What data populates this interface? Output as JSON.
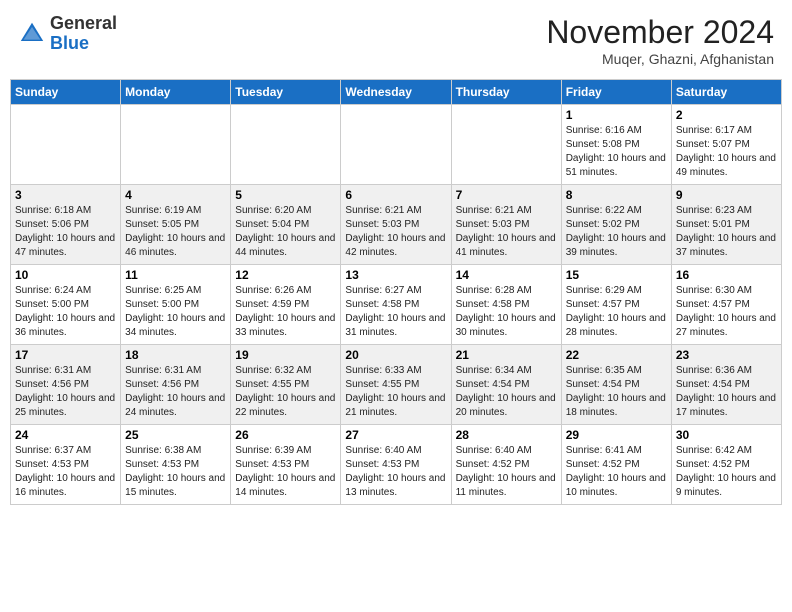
{
  "header": {
    "logo": {
      "general": "General",
      "blue": "Blue"
    },
    "month": "November 2024",
    "location": "Muqer, Ghazni, Afghanistan"
  },
  "weekdays": [
    "Sunday",
    "Monday",
    "Tuesday",
    "Wednesday",
    "Thursday",
    "Friday",
    "Saturday"
  ],
  "weeks": [
    [
      {
        "day": "",
        "info": ""
      },
      {
        "day": "",
        "info": ""
      },
      {
        "day": "",
        "info": ""
      },
      {
        "day": "",
        "info": ""
      },
      {
        "day": "",
        "info": ""
      },
      {
        "day": "1",
        "info": "Sunrise: 6:16 AM\nSunset: 5:08 PM\nDaylight: 10 hours and 51 minutes."
      },
      {
        "day": "2",
        "info": "Sunrise: 6:17 AM\nSunset: 5:07 PM\nDaylight: 10 hours and 49 minutes."
      }
    ],
    [
      {
        "day": "3",
        "info": "Sunrise: 6:18 AM\nSunset: 5:06 PM\nDaylight: 10 hours and 47 minutes."
      },
      {
        "day": "4",
        "info": "Sunrise: 6:19 AM\nSunset: 5:05 PM\nDaylight: 10 hours and 46 minutes."
      },
      {
        "day": "5",
        "info": "Sunrise: 6:20 AM\nSunset: 5:04 PM\nDaylight: 10 hours and 44 minutes."
      },
      {
        "day": "6",
        "info": "Sunrise: 6:21 AM\nSunset: 5:03 PM\nDaylight: 10 hours and 42 minutes."
      },
      {
        "day": "7",
        "info": "Sunrise: 6:21 AM\nSunset: 5:03 PM\nDaylight: 10 hours and 41 minutes."
      },
      {
        "day": "8",
        "info": "Sunrise: 6:22 AM\nSunset: 5:02 PM\nDaylight: 10 hours and 39 minutes."
      },
      {
        "day": "9",
        "info": "Sunrise: 6:23 AM\nSunset: 5:01 PM\nDaylight: 10 hours and 37 minutes."
      }
    ],
    [
      {
        "day": "10",
        "info": "Sunrise: 6:24 AM\nSunset: 5:00 PM\nDaylight: 10 hours and 36 minutes."
      },
      {
        "day": "11",
        "info": "Sunrise: 6:25 AM\nSunset: 5:00 PM\nDaylight: 10 hours and 34 minutes."
      },
      {
        "day": "12",
        "info": "Sunrise: 6:26 AM\nSunset: 4:59 PM\nDaylight: 10 hours and 33 minutes."
      },
      {
        "day": "13",
        "info": "Sunrise: 6:27 AM\nSunset: 4:58 PM\nDaylight: 10 hours and 31 minutes."
      },
      {
        "day": "14",
        "info": "Sunrise: 6:28 AM\nSunset: 4:58 PM\nDaylight: 10 hours and 30 minutes."
      },
      {
        "day": "15",
        "info": "Sunrise: 6:29 AM\nSunset: 4:57 PM\nDaylight: 10 hours and 28 minutes."
      },
      {
        "day": "16",
        "info": "Sunrise: 6:30 AM\nSunset: 4:57 PM\nDaylight: 10 hours and 27 minutes."
      }
    ],
    [
      {
        "day": "17",
        "info": "Sunrise: 6:31 AM\nSunset: 4:56 PM\nDaylight: 10 hours and 25 minutes."
      },
      {
        "day": "18",
        "info": "Sunrise: 6:31 AM\nSunset: 4:56 PM\nDaylight: 10 hours and 24 minutes."
      },
      {
        "day": "19",
        "info": "Sunrise: 6:32 AM\nSunset: 4:55 PM\nDaylight: 10 hours and 22 minutes."
      },
      {
        "day": "20",
        "info": "Sunrise: 6:33 AM\nSunset: 4:55 PM\nDaylight: 10 hours and 21 minutes."
      },
      {
        "day": "21",
        "info": "Sunrise: 6:34 AM\nSunset: 4:54 PM\nDaylight: 10 hours and 20 minutes."
      },
      {
        "day": "22",
        "info": "Sunrise: 6:35 AM\nSunset: 4:54 PM\nDaylight: 10 hours and 18 minutes."
      },
      {
        "day": "23",
        "info": "Sunrise: 6:36 AM\nSunset: 4:54 PM\nDaylight: 10 hours and 17 minutes."
      }
    ],
    [
      {
        "day": "24",
        "info": "Sunrise: 6:37 AM\nSunset: 4:53 PM\nDaylight: 10 hours and 16 minutes."
      },
      {
        "day": "25",
        "info": "Sunrise: 6:38 AM\nSunset: 4:53 PM\nDaylight: 10 hours and 15 minutes."
      },
      {
        "day": "26",
        "info": "Sunrise: 6:39 AM\nSunset: 4:53 PM\nDaylight: 10 hours and 14 minutes."
      },
      {
        "day": "27",
        "info": "Sunrise: 6:40 AM\nSunset: 4:53 PM\nDaylight: 10 hours and 13 minutes."
      },
      {
        "day": "28",
        "info": "Sunrise: 6:40 AM\nSunset: 4:52 PM\nDaylight: 10 hours and 11 minutes."
      },
      {
        "day": "29",
        "info": "Sunrise: 6:41 AM\nSunset: 4:52 PM\nDaylight: 10 hours and 10 minutes."
      },
      {
        "day": "30",
        "info": "Sunrise: 6:42 AM\nSunset: 4:52 PM\nDaylight: 10 hours and 9 minutes."
      }
    ]
  ]
}
